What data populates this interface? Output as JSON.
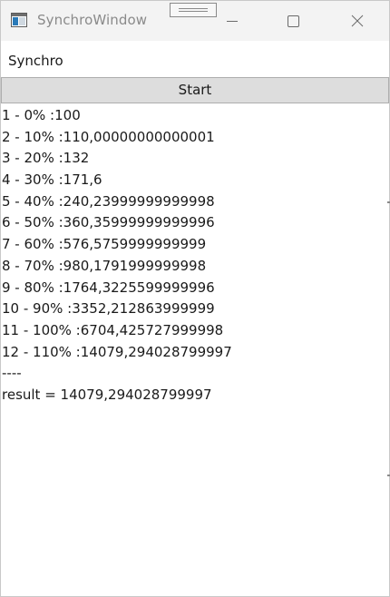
{
  "window": {
    "title": "SynchroWindow",
    "icon": "app-window-icon"
  },
  "controls": {
    "minimize_icon": "minimize-icon",
    "maximize_icon": "maximize-icon",
    "close_icon": "close-icon"
  },
  "header": {
    "label": "Synchro"
  },
  "start_button": {
    "label": "Start"
  },
  "output_lines": [
    "1 - 0% :100",
    "2 - 10% :110,00000000000001",
    "3 - 20% :132",
    "4 - 30% :171,6",
    "5 - 40% :240,23999999999998",
    "6 - 50% :360,35999999999996",
    "7 - 60% :576,5759999999999",
    "8 - 70% :980,1791999999998",
    "9 - 80% :1764,3225599999996",
    "10 - 90% :3352,212863999999",
    "11 - 100% :6704,425727999998",
    "12 - 110% :14079,294028799997",
    "----",
    "result = 14079,294028799997"
  ]
}
